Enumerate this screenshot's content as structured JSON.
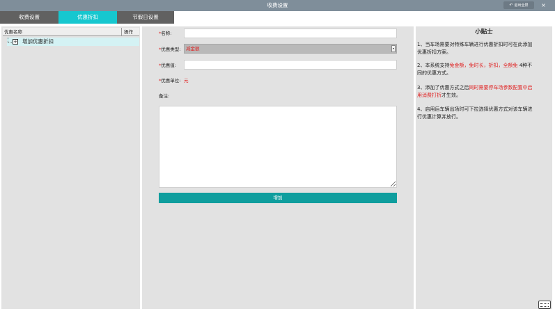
{
  "window": {
    "title": "收费设置",
    "exit_fullscreen_label": "退出全屏",
    "exit_icon": "arrow-icon",
    "close_icon": "close-icon",
    "close_glyph": "×"
  },
  "tabs": [
    {
      "label": "收费设置",
      "active": false
    },
    {
      "label": "优惠折扣",
      "active": true
    },
    {
      "label": "节假日设置",
      "active": false
    }
  ],
  "tree": {
    "col_name": "优惠名称",
    "col_op": "操作",
    "items": [
      {
        "label": "增加优惠折扣",
        "icon": "plus-box-icon",
        "glyph": "+"
      }
    ]
  },
  "form": {
    "required_mark": "*",
    "name_label": "名称:",
    "name_value": "",
    "type_label": "优惠类型:",
    "type_value": "减金额",
    "type_arrow_glyph": "▾",
    "value_label": "优惠值:",
    "value_value": "",
    "unit_label": "优惠单位:",
    "unit_value": "元",
    "remark_label": "备注:",
    "remark_value": "",
    "add_button": "增加"
  },
  "tips": {
    "title": "小贴士",
    "tip1": "1、当车场需要对特殊车辆进行优惠折扣时可在此添加优惠折扣方案。",
    "tip2_pre": "2、本系统支持",
    "tip2_types": "免金额，免时长，折扣，全额免",
    "tip2_post": " 4种不同的优惠方式。",
    "tip3_pre": "3、添加了优惠方式之后",
    "tip3_red": "同时需要停车场参数配置中启用消费打折",
    "tip3_post": "才生效。",
    "tip4": "4、启用后车辆出场时可下拉选择优惠方式对该车辆进行优惠计算并放行。"
  },
  "keyboard_icon": "keyboard-icon",
  "colors": {
    "titlebar": "#7f8e9a",
    "tab_inactive": "#616161",
    "tab_active": "#16c7cf",
    "button": "#0f9e9e",
    "required": "#e02020",
    "panel": "#e2e2e2"
  }
}
